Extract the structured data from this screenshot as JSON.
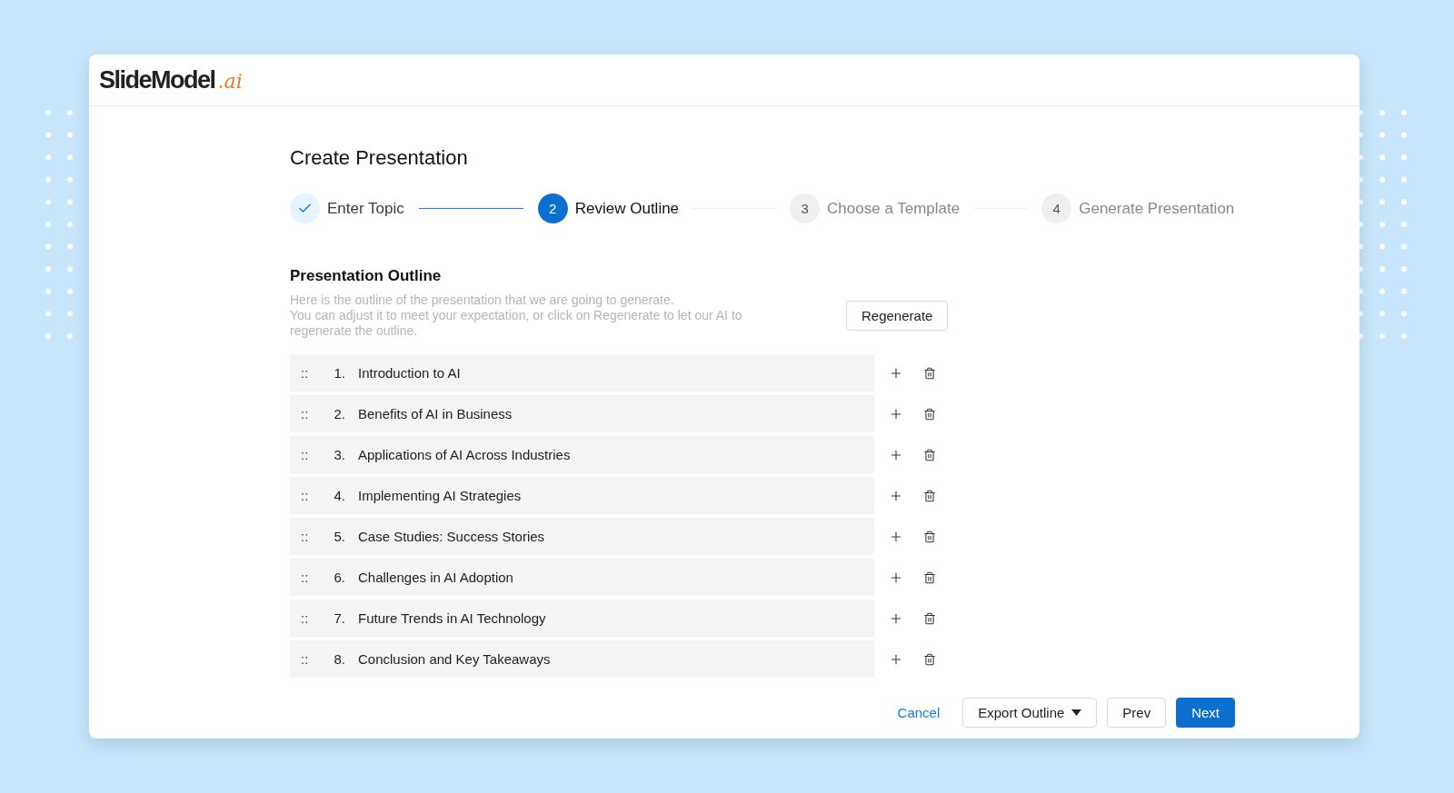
{
  "logo": {
    "name": "SlideModel",
    "suffix": ".ai"
  },
  "title": "Create Presentation",
  "steps": [
    {
      "label": "Enter Topic",
      "completed": true,
      "selected": false
    },
    {
      "number": "2",
      "label": "Review Outline",
      "completed": false,
      "selected": true
    },
    {
      "number": "3",
      "label": "Choose a Template",
      "completed": false,
      "selected": false
    },
    {
      "number": "4",
      "label": "Generate Presentation",
      "completed": false,
      "selected": false
    }
  ],
  "outline": {
    "heading": "Presentation Outline",
    "description": "Here is the outline of the presentation that we are going to generate.\nYou can adjust it to meet your expectation, or click on Regenerate to let our AI to regenerate the outline.",
    "regenerate": "Regenerate",
    "items": [
      {
        "handle": "::",
        "number": "1.",
        "title": "Introduction to AI"
      },
      {
        "handle": "::",
        "number": "2.",
        "title": "Benefits of AI in Business"
      },
      {
        "handle": "::",
        "number": "3.",
        "title": "Applications of AI Across Industries"
      },
      {
        "handle": "::",
        "number": "4.",
        "title": "Implementing AI Strategies"
      },
      {
        "handle": "::",
        "number": "5.",
        "title": "Case Studies: Success Stories"
      },
      {
        "handle": "::",
        "number": "6.",
        "title": "Challenges in AI Adoption"
      },
      {
        "handle": "::",
        "number": "7.",
        "title": "Future Trends in AI Technology"
      },
      {
        "handle": "::",
        "number": "8.",
        "title": "Conclusion and Key Takeaways"
      }
    ]
  },
  "footer": {
    "cancel": "Cancel",
    "export": "Export Outline",
    "prev": "Prev",
    "next": "Next"
  }
}
